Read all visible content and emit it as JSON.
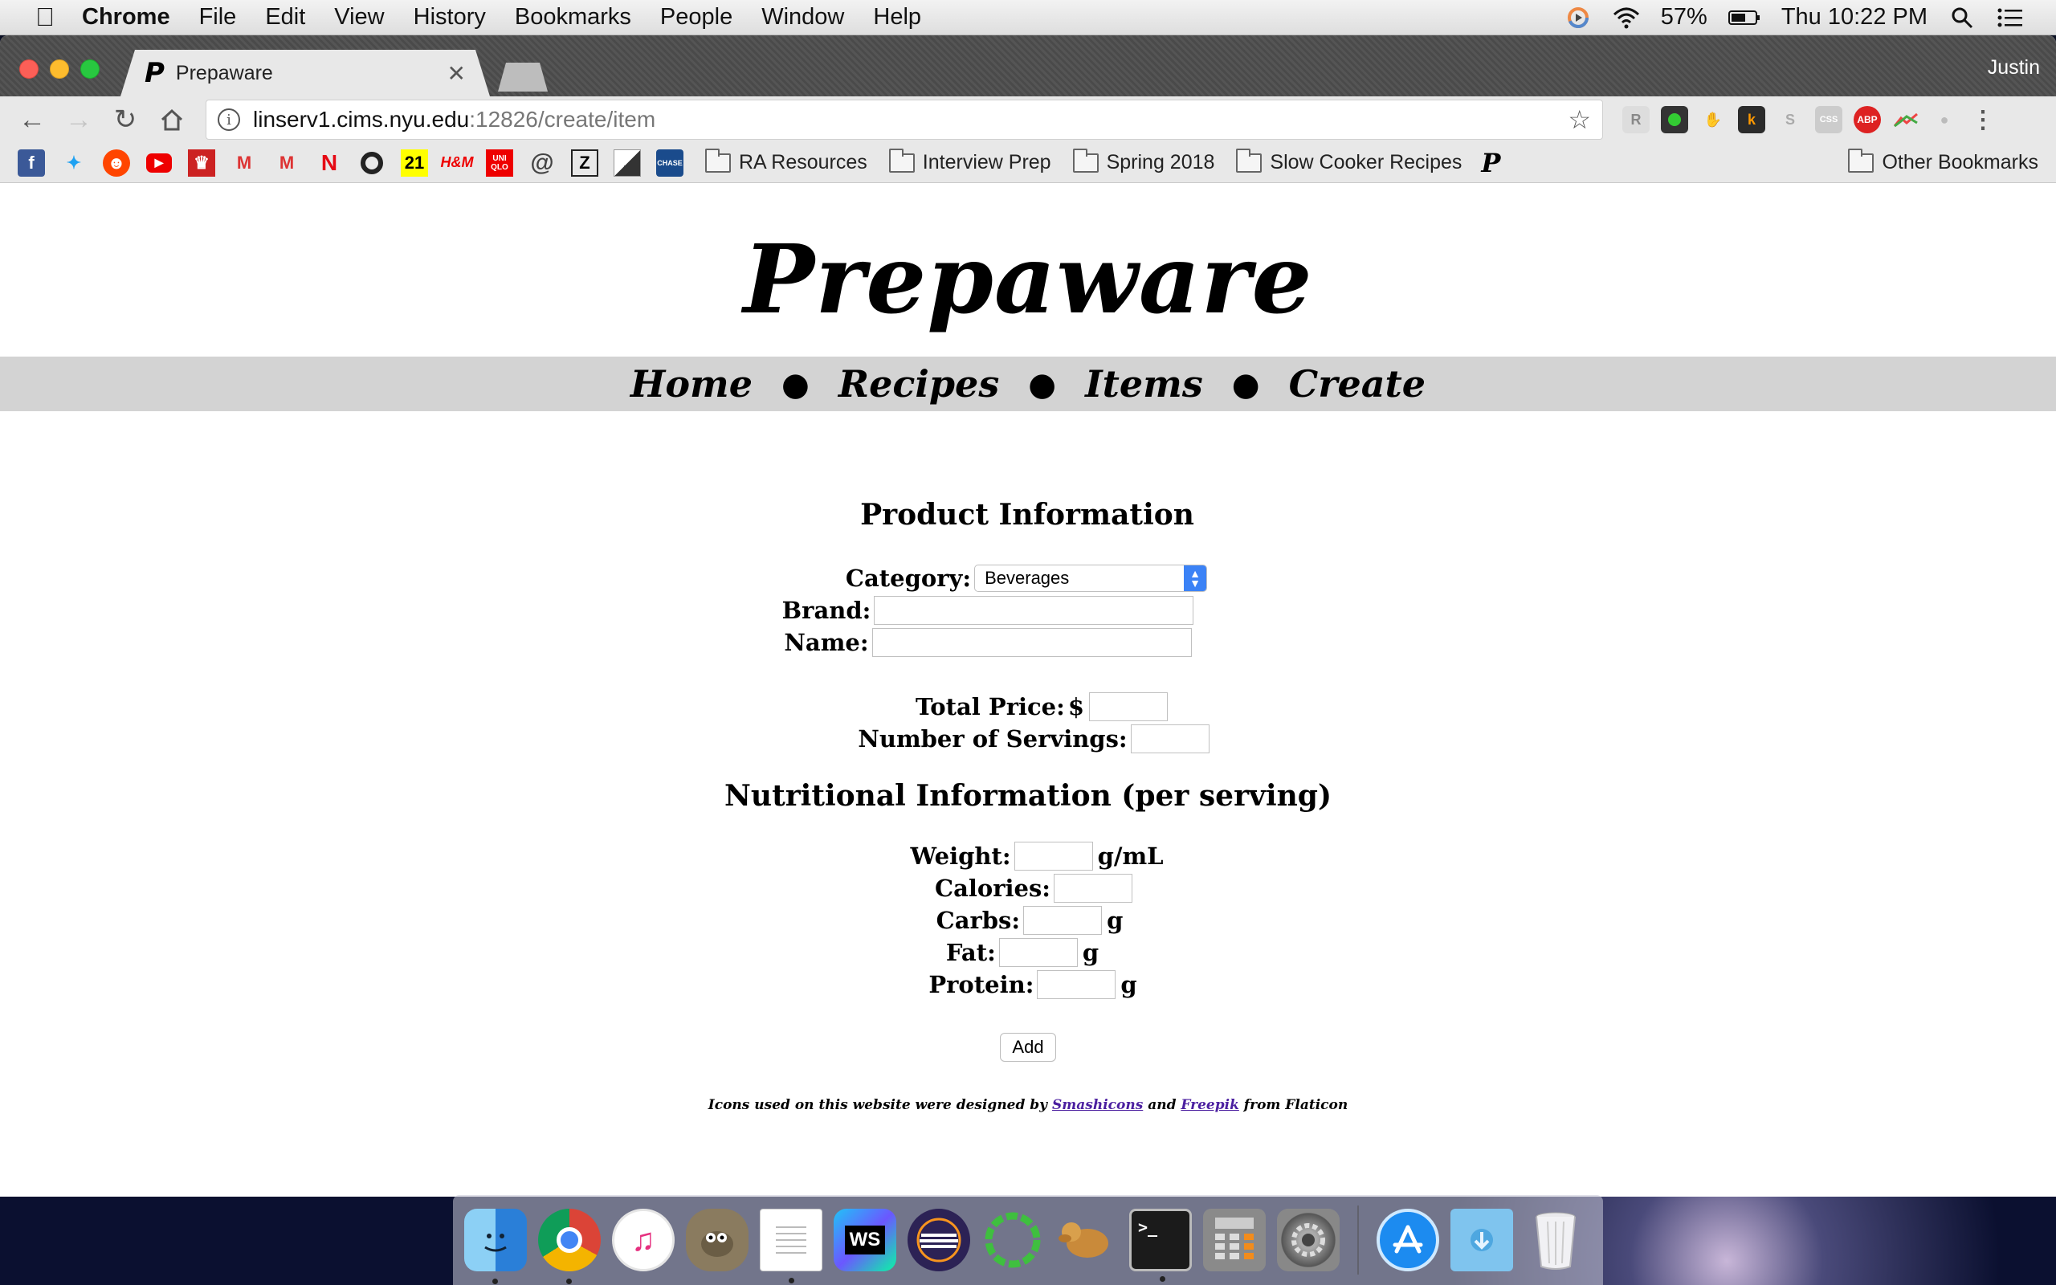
{
  "menubar": {
    "app_name": "Chrome",
    "items": [
      "File",
      "Edit",
      "View",
      "History",
      "Bookmarks",
      "People",
      "Window",
      "Help"
    ],
    "battery": "57%",
    "clock": "Thu 10:22 PM"
  },
  "browser": {
    "tab_title": "Prepaware",
    "profile": "Justin",
    "url_host": "linserv1.cims.nyu.edu",
    "url_path": ":12826/create/item",
    "bookmark_folders": [
      "RA Resources",
      "Interview Prep",
      "Spring 2018",
      "Slow Cooker Recipes"
    ],
    "other_bookmarks": "Other Bookmarks",
    "bookmark_favicons": [
      "facebook",
      "twitter",
      "reddit",
      "youtube",
      "crown",
      "gmail",
      "gmail",
      "netflix",
      "circle",
      "21",
      "H&M",
      "UNIQLO",
      "at-sign",
      "zara",
      "stripe",
      "chase",
      "prepaware"
    ],
    "extensions": [
      "ext-r",
      "ext-green",
      "ext-hand",
      "ext-k",
      "ext-s",
      "ext-css",
      "ext-abp",
      "ext-chart",
      "ext-reddit",
      "menu"
    ]
  },
  "site": {
    "title": "Prepaware",
    "nav": [
      "Home",
      "Recipes",
      "Items",
      "Create"
    ]
  },
  "form": {
    "product_heading": "Product Information",
    "category_label": "Category:",
    "category_value": "Beverages",
    "brand_label": "Brand:",
    "name_label": "Name:",
    "price_label": "Total Price:",
    "price_prefix": "$",
    "servings_label": "Number of Servings:",
    "nutrition_heading": "Nutritional Information (per serving)",
    "weight_label": "Weight:",
    "weight_unit": "g/mL",
    "calories_label": "Calories:",
    "carbs_label": "Carbs:",
    "carbs_unit": "g",
    "fat_label": "Fat:",
    "fat_unit": "g",
    "protein_label": "Protein:",
    "protein_unit": "g",
    "add_button": "Add"
  },
  "credits": {
    "prefix": "Icons used on this website were designed by",
    "link1": "Smashicons",
    "middle": "and",
    "link2": "Freepik",
    "suffix": "from Flaticon"
  },
  "dock": [
    "finder",
    "chrome",
    "itunes",
    "gimp",
    "textedit",
    "webstorm",
    "eclipse",
    "cycle",
    "sequel-pro",
    "terminal",
    "calculator",
    "system-preferences",
    "app-store",
    "downloads",
    "trash"
  ],
  "colors": {
    "nav_bar": "#d3d3d3",
    "select_accent": "#3b82f6",
    "credit_link": "#4b1fa0"
  }
}
